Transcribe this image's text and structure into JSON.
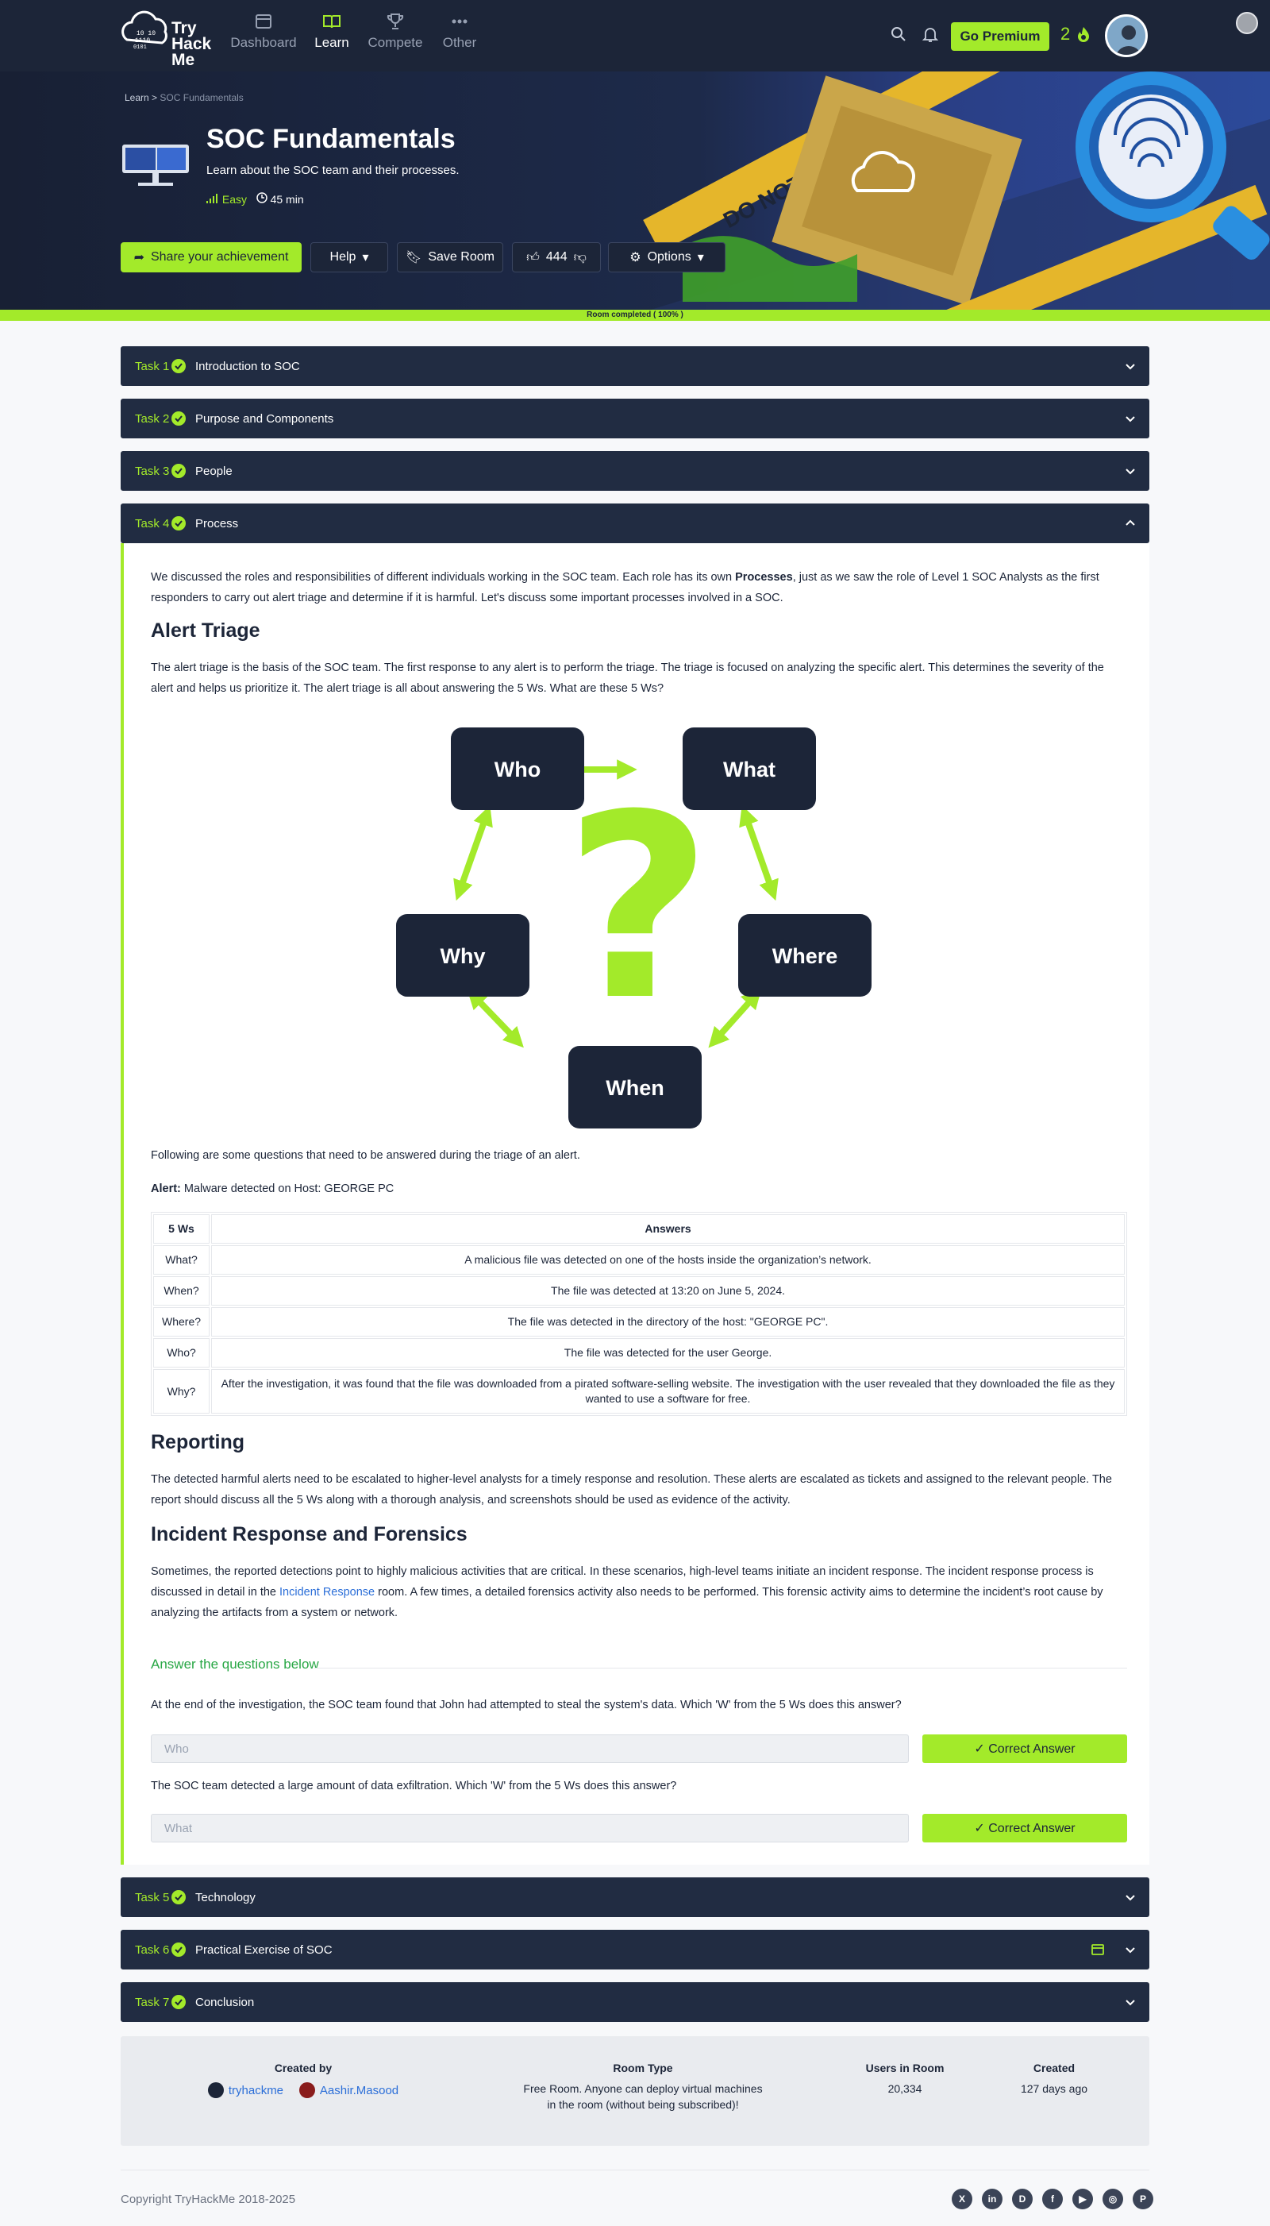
{
  "nav": {
    "logo_lines": [
      "Try",
      "Hack",
      "Me"
    ],
    "items": [
      {
        "label": "Dashboard",
        "icon": "dashboard-icon"
      },
      {
        "label": "Learn",
        "icon": "book-icon"
      },
      {
        "label": "Compete",
        "icon": "trophy-icon"
      },
      {
        "label": "Other",
        "icon": "dots-icon"
      }
    ],
    "premium_label": "Go Premium",
    "streak": "2",
    "accent": "#a3ea2a"
  },
  "hero": {
    "breadcrumb_root": "Learn",
    "breadcrumb_sep": ">",
    "breadcrumb_current": "SOC Fundamentals",
    "title": "SOC Fundamentals",
    "description": "Learn about the SOC team and their processes.",
    "difficulty": "Easy",
    "duration": "45 min",
    "share_label": "Share your achievement",
    "help_label": "Help",
    "save_label": "Save Room",
    "likes": "444",
    "options_label": "Options",
    "progress_text": "Room completed ( 100% )",
    "progress_value": 100,
    "art_text": "DO NOT CROSS"
  },
  "tasks": [
    {
      "num": "Task 1",
      "title": "Introduction to SOC"
    },
    {
      "num": "Task 2",
      "title": "Purpose and Components"
    },
    {
      "num": "Task 3",
      "title": "People"
    },
    {
      "num": "Task 4",
      "title": "Process"
    },
    {
      "num": "Task 5",
      "title": "Technology"
    },
    {
      "num": "Task 6",
      "title": "Practical Exercise of SOC"
    },
    {
      "num": "Task 7",
      "title": "Conclusion"
    }
  ],
  "task4": {
    "intro_pre": "We discussed the roles and responsibilities of different individuals working in the SOC team. Each role has its own ",
    "intro_bold": "Processes",
    "intro_post": ", just as we saw the role of Level 1 SOC Analysts as the first responders to carry out alert triage and determine if it is harmful. Let's discuss some important processes involved in a SOC.",
    "h_triage": "Alert Triage",
    "triage_text": "The alert triage is the basis of the SOC team. The first response to any alert is to perform the triage. The triage is focused on analyzing the specific alert. This determines the severity of the alert and helps us prioritize it. The alert triage is all about answering the 5 Ws. What are these 5 Ws?",
    "diagram": {
      "who": "Who",
      "what": "What",
      "where": "Where",
      "when": "When",
      "why": "Why",
      "center": "?"
    },
    "following": "Following are some questions that need to be answered during the triage of an alert.",
    "alert_label": "Alert:",
    "alert_text": " Malware detected on Host: GEORGE PC",
    "table": {
      "headers": [
        "5 Ws",
        "Answers"
      ],
      "rows": [
        [
          "What?",
          "A malicious file was detected on one of the hosts inside the organization’s network."
        ],
        [
          "When?",
          "The file was detected at 13:20 on June 5, 2024."
        ],
        [
          "Where?",
          "The file was detected in the directory of the host: \"GEORGE PC\"."
        ],
        [
          "Who?",
          "The file was detected for the user George."
        ],
        [
          "Why?",
          "After the investigation, it was found that the file was downloaded from a pirated software-selling website. The investigation with the user revealed that they downloaded the file as they wanted to use a software for free."
        ]
      ]
    },
    "h_reporting": "Reporting",
    "reporting_text": "The detected harmful alerts need to be escalated to higher-level analysts for a timely response and resolution. These alerts are escalated as tickets and assigned to the relevant people. The report should discuss all the 5 Ws along with a thorough analysis, and screenshots should be used as evidence of the activity.",
    "h_ir": "Incident Response and Forensics",
    "ir_pre": "Sometimes, the reported detections point to highly malicious activities that are critical. In these scenarios, high-level teams initiate an incident response. The incident response process is discussed in detail in the ",
    "ir_link": "Incident Response",
    "ir_post": " room. A few times, a detailed forensics activity also needs to be performed. This forensic activity aims to determine the incident’s root cause by analyzing the artifacts from a system or network.",
    "answers_heading": "Answer the questions below",
    "questions": [
      {
        "q": "At the end of the investigation, the SOC team found that John had attempted to steal the system's data. Which 'W' from the 5 Ws does this answer?",
        "answer": "Who",
        "button": "Correct Answer"
      },
      {
        "q": "The SOC team detected a large amount of data exfiltration. Which 'W' from the 5 Ws does this answer?",
        "answer": "What",
        "button": "Correct Answer"
      }
    ]
  },
  "info": {
    "created_by_label": "Created by",
    "authors": [
      "tryhackme",
      "Aashir.Masood"
    ],
    "room_type_label": "Room Type",
    "room_type_line1": "Free Room. Anyone can deploy virtual machines",
    "room_type_line2": "in the room (without being subscribed)!",
    "users_label": "Users in Room",
    "users": "20,334",
    "created_label": "Created",
    "created": "127 days ago"
  },
  "footer": {
    "copyright": "Copyright TryHackMe 2018-2025",
    "socials": [
      {
        "name": "x-icon",
        "glyph": "X"
      },
      {
        "name": "linkedin-icon",
        "glyph": "in"
      },
      {
        "name": "discord-icon",
        "glyph": "D"
      },
      {
        "name": "facebook-icon",
        "glyph": "f"
      },
      {
        "name": "youtube-icon",
        "glyph": "▶"
      },
      {
        "name": "instagram-icon",
        "glyph": "◎"
      },
      {
        "name": "pinterest-icon",
        "glyph": "P"
      }
    ]
  }
}
